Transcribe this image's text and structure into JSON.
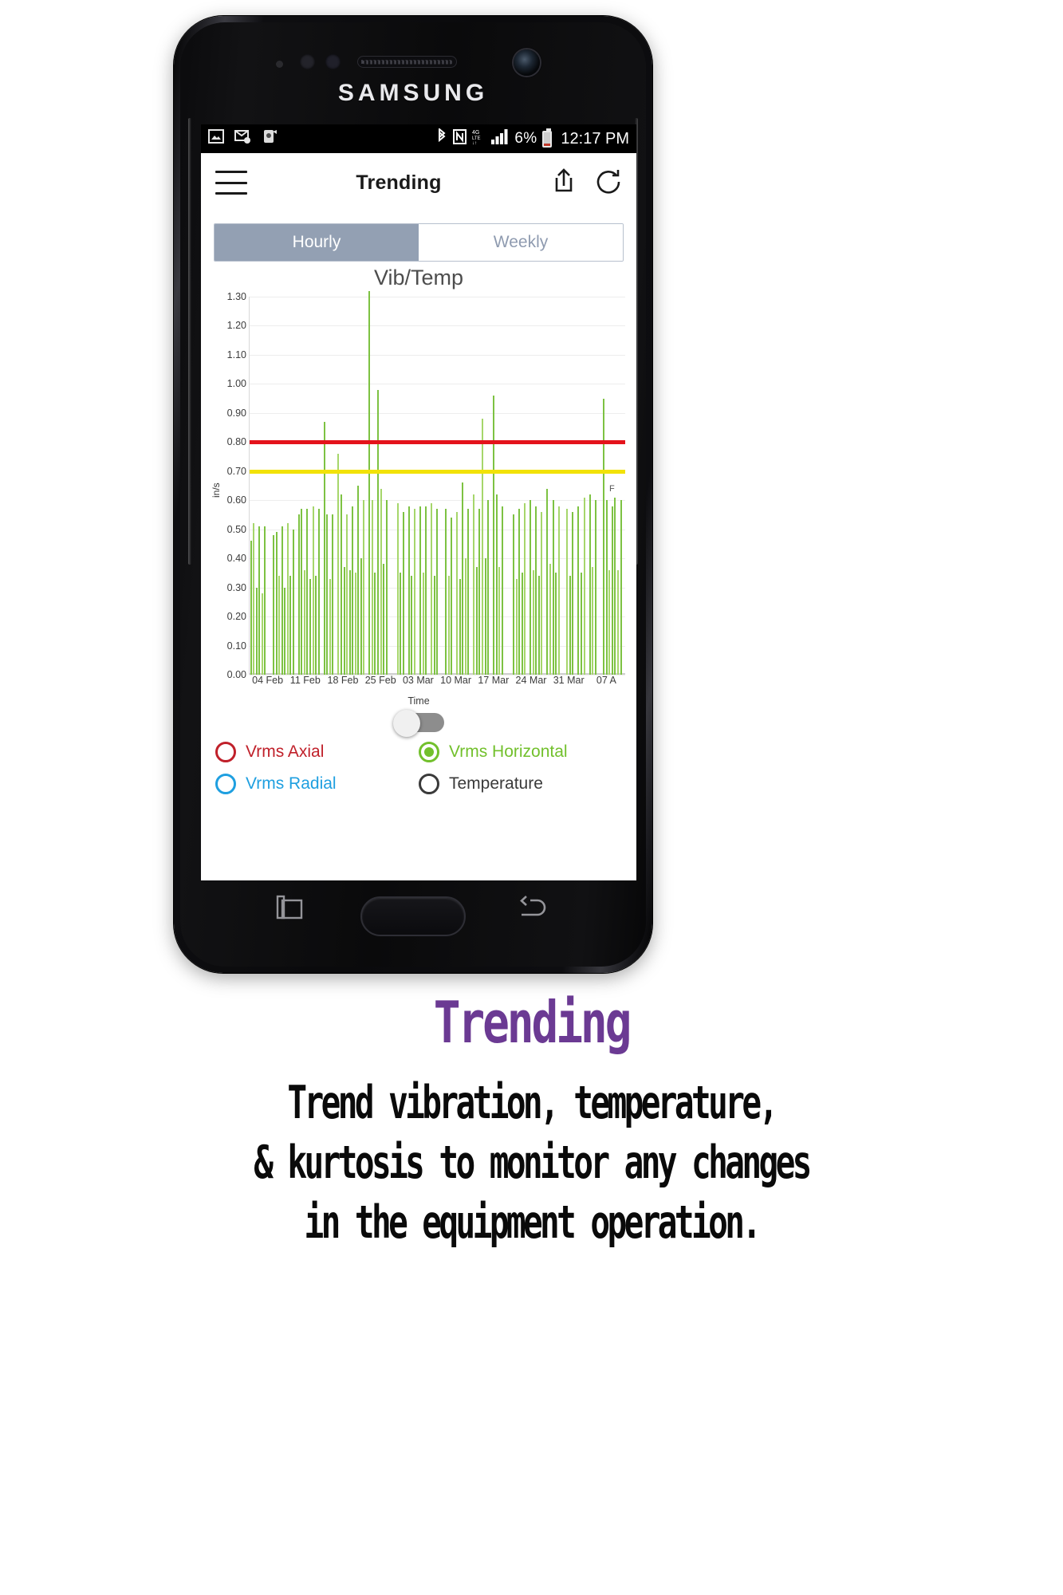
{
  "device": {
    "brand": "SAMSUNG"
  },
  "statusbar": {
    "left_icons": [
      "image-icon",
      "email-icon",
      "app-icon"
    ],
    "right_icons": [
      "bluetooth-icon",
      "nfc-icon",
      "4g-lte-icon",
      "signal-bars-icon"
    ],
    "battery_percent": "6%",
    "time": "12:17 PM"
  },
  "appbar": {
    "menu_icon": "hamburger-menu-icon",
    "title": "Trending",
    "share_icon": "share-icon",
    "refresh_icon": "refresh-icon"
  },
  "tabs": [
    {
      "label": "Hourly",
      "active": true
    },
    {
      "label": "Weekly",
      "active": false
    }
  ],
  "toggle": {
    "state": "off"
  },
  "legend": [
    {
      "label": "Vrms Axial",
      "color": "#c0202a",
      "selected": false
    },
    {
      "label": "Vrms Horizontal",
      "color": "#72c02c",
      "selected": true
    },
    {
      "label": "Vrms Radial",
      "color": "#1e9fe0",
      "selected": false
    },
    {
      "label": "Temperature",
      "color": "#3a3a3a",
      "selected": false
    }
  ],
  "caption": {
    "title": "Trending",
    "lines": [
      "Trend vibration, temperature,",
      "& kurtosis to monitor any changes",
      "in the equipment operation."
    ],
    "title_color": "#6b3a93"
  },
  "chart_data": {
    "type": "bar",
    "title": "Vib/Temp",
    "xlabel": "Time",
    "ylabel": "in/s",
    "ylim": [
      0.0,
      1.3
    ],
    "yticks": [
      "0.00",
      "0.10",
      "0.20",
      "0.30",
      "0.40",
      "0.50",
      "0.60",
      "0.70",
      "0.80",
      "0.90",
      "1.00",
      "1.10",
      "1.20",
      "1.30"
    ],
    "xticks": [
      "04 Feb",
      "11 Feb",
      "18 Feb",
      "25 Feb",
      "03 Mar",
      "10 Mar",
      "17 Mar",
      "24 Mar",
      "31 Mar",
      "07 A"
    ],
    "grid": true,
    "legend_position": "below-chart",
    "series_name": "Vrms Horizontal",
    "series_color": "#7dc242",
    "thresholds": [
      {
        "name": "alarm",
        "value": 0.8,
        "color": "#e4131b"
      },
      {
        "name": "warning",
        "value": 0.7,
        "color": "#f2e208"
      }
    ],
    "annotation": "F",
    "values": [
      0.46,
      0.52,
      0.3,
      0.51,
      0.28,
      0.51,
      0.0,
      0.0,
      0.48,
      0.49,
      0.34,
      0.51,
      0.3,
      0.52,
      0.34,
      0.5,
      0.0,
      0.55,
      0.57,
      0.36,
      0.57,
      0.33,
      0.58,
      0.34,
      0.57,
      0.0,
      0.87,
      0.55,
      0.33,
      0.55,
      0.0,
      0.76,
      0.62,
      0.37,
      0.55,
      0.36,
      0.58,
      0.35,
      0.65,
      0.4,
      0.6,
      0.0,
      1.32,
      0.6,
      0.35,
      0.98,
      0.64,
      0.38,
      0.6,
      0.0,
      0.0,
      0.0,
      0.59,
      0.35,
      0.56,
      0.0,
      0.58,
      0.34,
      0.57,
      0.0,
      0.58,
      0.35,
      0.58,
      0.0,
      0.59,
      0.34,
      0.57,
      0.0,
      0.0,
      0.57,
      0.34,
      0.54,
      0.0,
      0.56,
      0.33,
      0.66,
      0.4,
      0.57,
      0.0,
      0.62,
      0.37,
      0.57,
      0.88,
      0.4,
      0.6,
      0.0,
      0.96,
      0.62,
      0.37,
      0.58,
      0.0,
      0.0,
      0.0,
      0.55,
      0.33,
      0.57,
      0.35,
      0.59,
      0.0,
      0.6,
      0.36,
      0.58,
      0.34,
      0.56,
      0.0,
      0.64,
      0.38,
      0.6,
      0.35,
      0.58,
      0.0,
      0.0,
      0.57,
      0.34,
      0.56,
      0.0,
      0.58,
      0.35,
      0.61,
      0.0,
      0.62,
      0.37,
      0.6,
      0.0,
      0.0,
      0.95,
      0.6,
      0.36,
      0.58,
      0.61,
      0.36,
      0.6,
      0.0
    ]
  }
}
